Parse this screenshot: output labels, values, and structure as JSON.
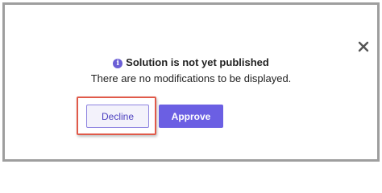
{
  "dialog": {
    "title": "Solution is not yet published",
    "message": "There are no modifications to be displayed.",
    "info_icon_glyph": "i",
    "close_icon": "close-icon",
    "info_icon": "info-icon"
  },
  "actions": {
    "decline_label": "Decline",
    "approve_label": "Approve"
  },
  "colors": {
    "accent": "#6b5fe3",
    "highlight": "#e05a4a",
    "frame": "#9e9e9e"
  }
}
